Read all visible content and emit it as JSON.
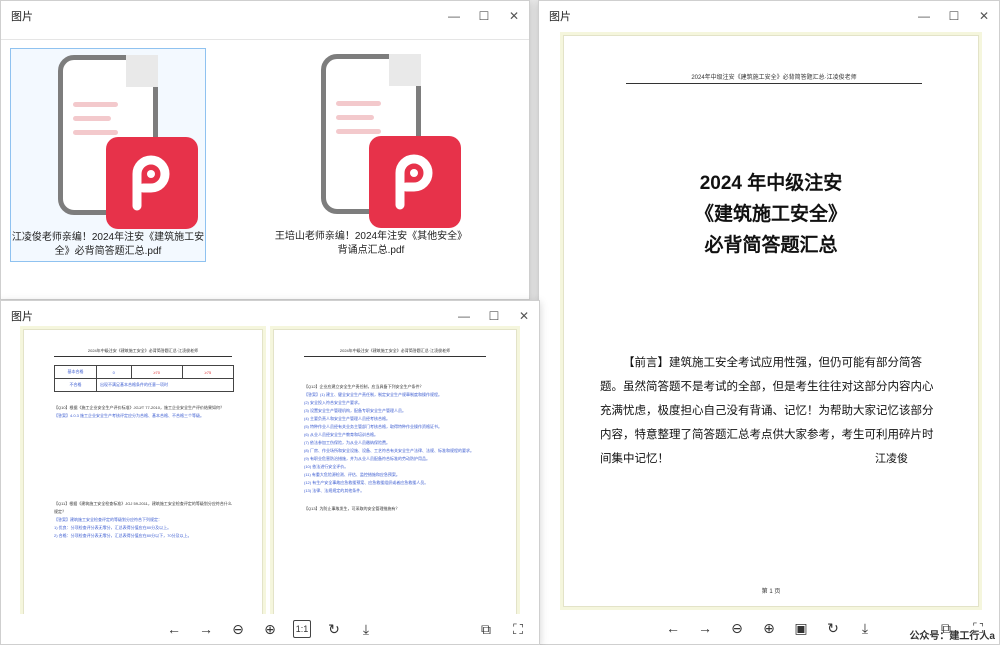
{
  "window_top_left": {
    "title": "图片",
    "files": [
      {
        "name": "江凌俊老师亲编！2024年注安《建筑施工安全》必背简答题汇总.pdf",
        "selected": true
      },
      {
        "name": "王培山老师亲编！2024年注安《其他安全》背诵点汇总.pdf",
        "selected": false
      }
    ]
  },
  "window_bottom_left": {
    "title": "图片",
    "left_page": {
      "header": "2024年中级注安《建筑施工安全》必背简答题汇总·江凌俊老师",
      "table_rows": [
        [
          "基本合格",
          "0",
          "≥70",
          "≥75"
        ],
        [
          "不合格",
          "出现不满足基本合格条件的任意一项时",
          "",
          ""
        ]
      ],
      "lines": [
        "【Q10】根据《施工企业安全生产评价标准》JGJ/T 77-2010，施工企业安全生产评价结果如何？",
        "【答案】4.0.3 施工企业安全生产考核评定应分为合格、基本合格、不合格三个等级。",
        "【Q11】根据《建筑施工安全检查标准》JGJ 59-2011，建筑施工安全检查评定的等级划分应符合什么规定？",
        "【答案】建筑施工安全检查评定的等级划分应符合下列规定：",
        "1) 优良：分项检查评分表无零分，汇总表得分值应在80分及以上。",
        "2) 合格：分项检查评分表无零分，汇总表得分值应在80分以下，70分及以上。"
      ]
    },
    "right_page": {
      "header": "2024年中级注安《建筑施工安全》必背简答题汇总·江凌俊老师",
      "lines": [
        "【Q12】企业应建立安全生产责任制，应当具备下列安全生产条件？",
        "【答案】(1) 建立、健全安全生产责任制，制定安全生产规章制度和操作规程。",
        "(2) 安全投入符合安全生产要求。",
        "(3) 设置安全生产管理机构，配备专职安全生产管理人员。",
        "(4) 主要负责人和安全生产管理人员经考核合格。",
        "(5) 特种作业人员经有关业务主管部门考核合格，取得特种作业操作资格证书。",
        "(6) 从业人员经安全生产教育和培训合格。",
        "(7) 依法参加工伤保险，为从业人员缴纳保险费。",
        "(8) 厂房、作业场所和安全设施、设备、工艺符合有关安全生产法律、法规、标准和规程的要求。",
        "(9) 有职业危害防治措施，并为从业人员配备符合标准的劳动防护用品。",
        "(10) 依法进行安全评价。",
        "(11) 有重大危险源检测、评估、监控措施和应急预案。",
        "(12) 有生产安全事故应急救援预案、应急救援组织或者应急救援人员。",
        "(13) 法律、法规规定的其他条件。",
        "【Q13】为防止事故发生，可采取的安全管理措施有？"
      ]
    }
  },
  "window_right": {
    "title": "图片",
    "page": {
      "header": "2024年中级注安《建筑施工安全》必背简答题汇总·江凌俊老师",
      "title_line1": "2024 年中级注安",
      "title_line2": "《建筑施工安全》",
      "title_line3": "必背简答题汇总",
      "preface": "【前言】建筑施工安全考试应用性强，但仍可能有部分简答题。虽然简答题不是考试的全部，但是考生往往对这部分内容内心充满忧虑，极度担心自己没有背诵、记忆！为帮助大家记忆该部分内容，特意整理了简答题汇总考点供大家参考，考生可利用碎片时间集中记忆！",
      "author": "江凌俊",
      "page_no": "第 1 页"
    },
    "watermark": "公众号：建工行人a"
  },
  "toolbar_icons": [
    "arrow-left-icon",
    "arrow-right-icon",
    "zoom-out-icon",
    "zoom-in-icon",
    "actual-size-icon",
    "rotate-icon",
    "download-icon"
  ],
  "colors": {
    "pdf_red": "#e7324a",
    "blue_text": "#3a5bd0"
  }
}
